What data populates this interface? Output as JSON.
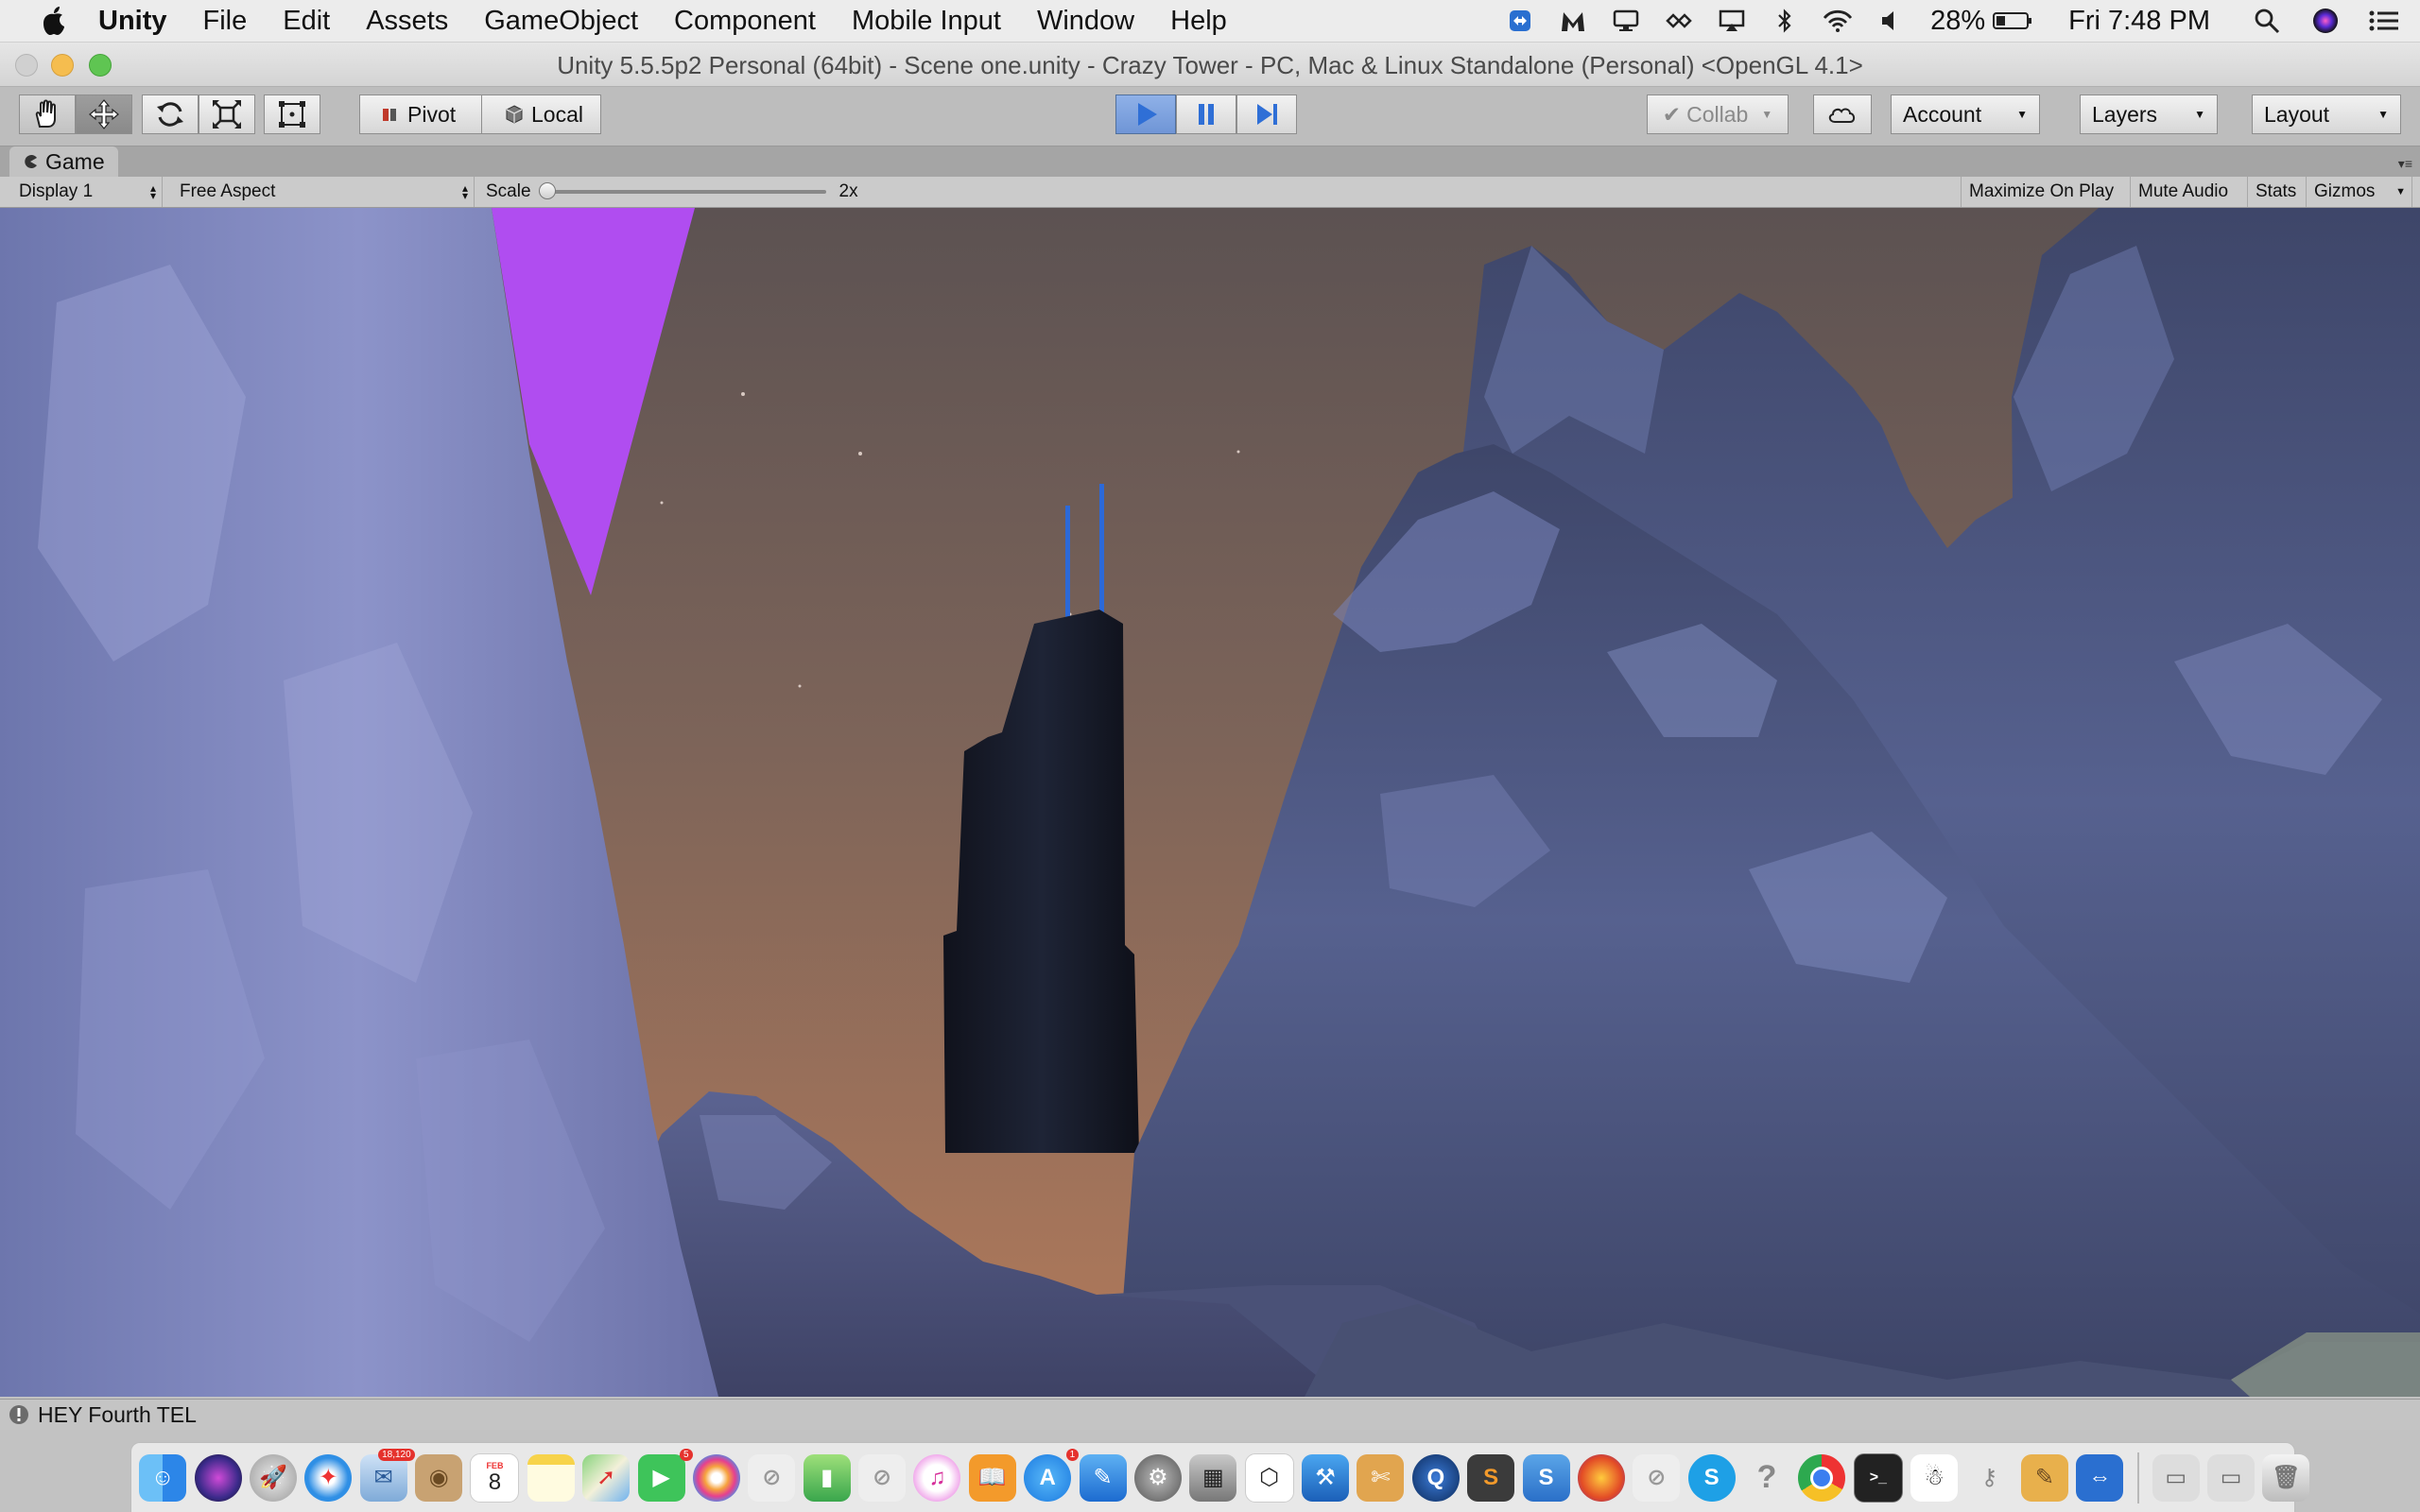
{
  "menubar": {
    "app": "Unity",
    "items": [
      "File",
      "Edit",
      "Assets",
      "GameObject",
      "Component",
      "Mobile Input",
      "Window",
      "Help"
    ],
    "battery": "28%",
    "clock": "Fri 7:48 PM"
  },
  "window": {
    "title": "Unity 5.5.5p2 Personal (64bit) - Scene one.unity - Crazy Tower - PC, Mac & Linux Standalone (Personal) <OpenGL 4.1>"
  },
  "toolbar": {
    "tools": [
      "hand-tool",
      "move-tool",
      "rotate-tool",
      "scale-tool",
      "rect-tool"
    ],
    "pivot": "Pivot",
    "local": "Local",
    "collab": "Collab",
    "account": "Account",
    "layers": "Layers",
    "layout": "Layout",
    "play_state": "playing"
  },
  "game": {
    "tab": "Game",
    "display": "Display 1",
    "aspect": "Free Aspect",
    "scale_label": "Scale",
    "scale_value": "2x",
    "maximize": "Maximize On Play",
    "mute": "Mute Audio",
    "stats": "Stats",
    "gizmos": "Gizmos"
  },
  "console": {
    "message": "HEY Fourth TEL"
  },
  "dock": {
    "mail_badge": "18,120",
    "calendar_month": "FEB",
    "calendar_day": "8",
    "messages_badge": "5",
    "appstore_badge": "1"
  },
  "colors": {
    "play_active": "#2f6fd6",
    "sky": "#8a6a5c",
    "rock": "#5a648f",
    "magenta": "#b04df0"
  }
}
